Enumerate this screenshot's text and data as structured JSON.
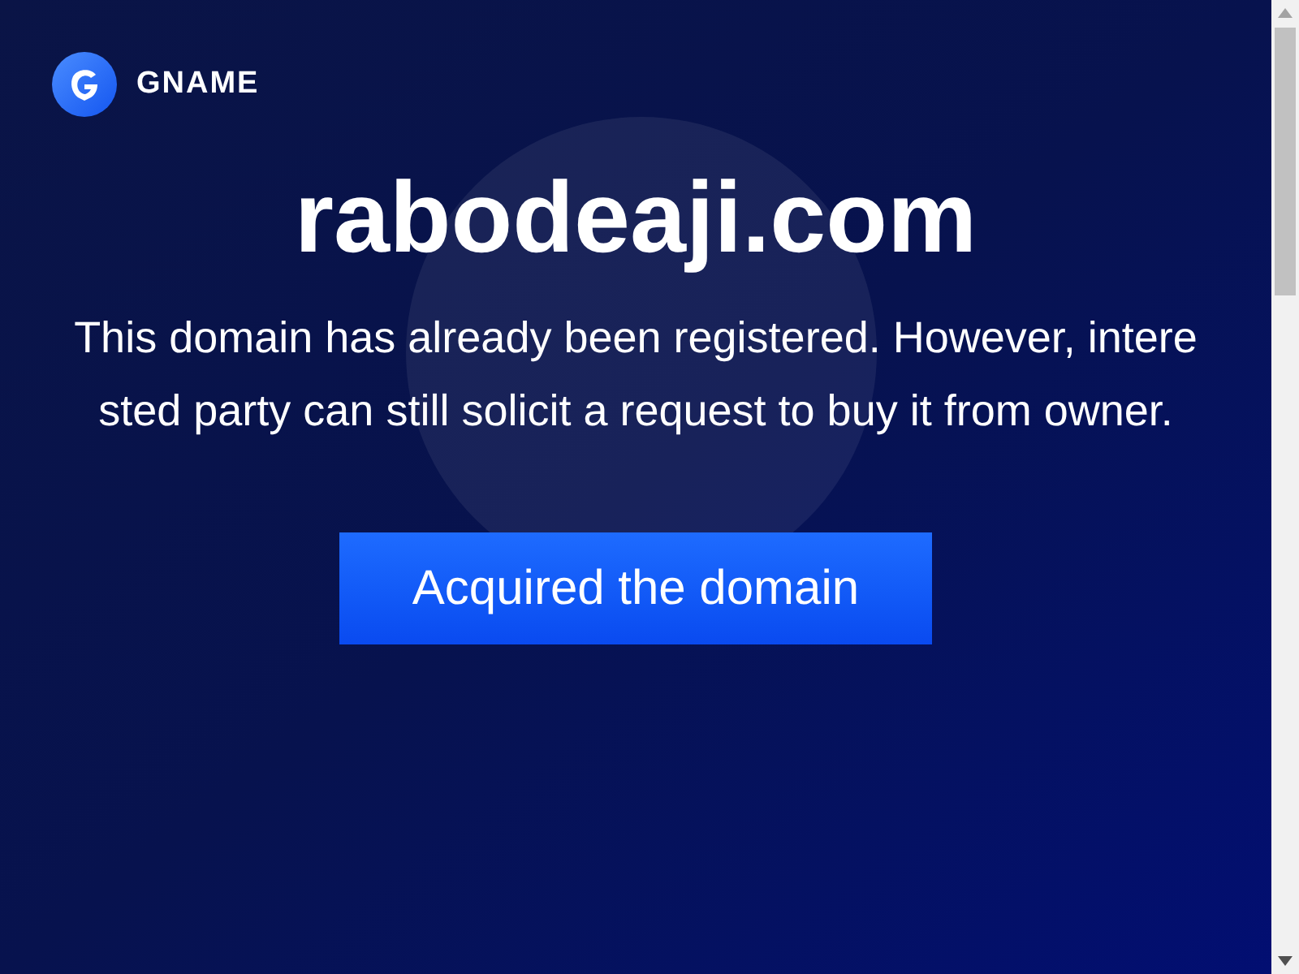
{
  "brand": {
    "name": "GNAME"
  },
  "domain": "rabodeaji.com",
  "message": "This domain has already been registered. However, interested party can still solicit a request to buy it from owner.",
  "button": {
    "label": "Acquired the domain"
  }
}
